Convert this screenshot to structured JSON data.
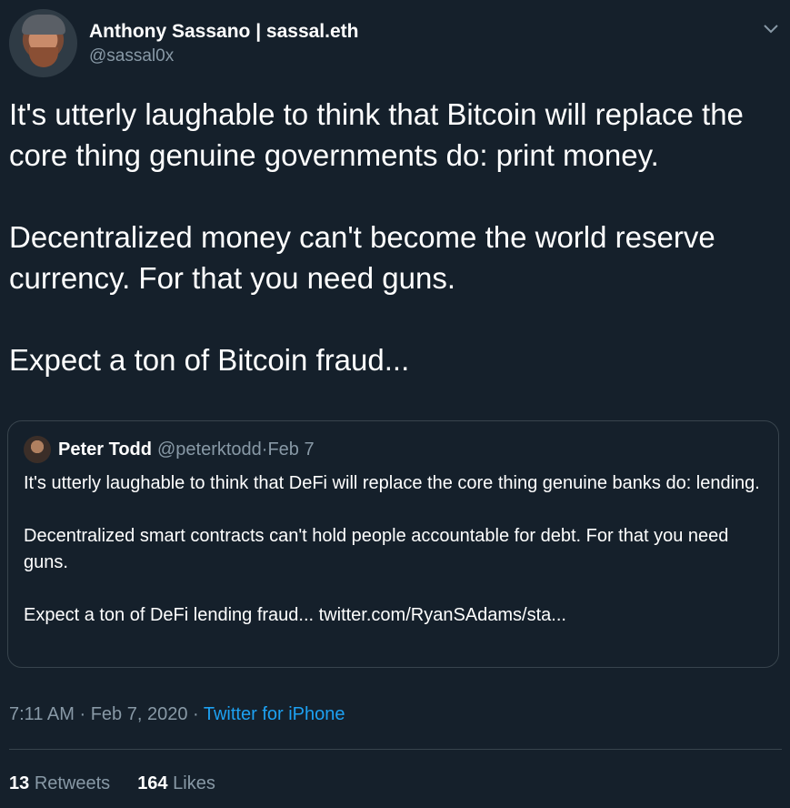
{
  "author": {
    "display_name": "Anthony Sassano | sassal.eth",
    "handle": "@sassal0x"
  },
  "tweet": {
    "paragraphs": [
      "It's utterly laughable to think that Bitcoin will replace the core thing genuine governments do: print money.",
      "Decentralized money can't become the world reserve currency. For that you need guns.",
      "Expect a ton of Bitcoin fraud..."
    ]
  },
  "quoted_tweet": {
    "display_name": "Peter Todd",
    "handle": "@peterktodd",
    "date": "Feb 7",
    "paragraphs": [
      "It's utterly laughable to think that DeFi will replace the core thing genuine banks do: lending.",
      "Decentralized smart contracts can't hold people accountable for debt. For that you need guns.",
      "Expect a ton of DeFi lending fraud... twitter.com/RyanSAdams/sta..."
    ]
  },
  "meta": {
    "time": "7:11 AM",
    "date": "Feb 7, 2020",
    "source": "Twitter for iPhone",
    "separator": " · "
  },
  "stats": {
    "retweets_count": "13",
    "retweets_label": "Retweets",
    "likes_count": "164",
    "likes_label": "Likes"
  },
  "icons": {
    "more": "chevron-down-icon"
  },
  "colors": {
    "background": "#15202b",
    "secondary_text": "#8899a6",
    "link": "#1da1f2",
    "border": "#38444d"
  }
}
